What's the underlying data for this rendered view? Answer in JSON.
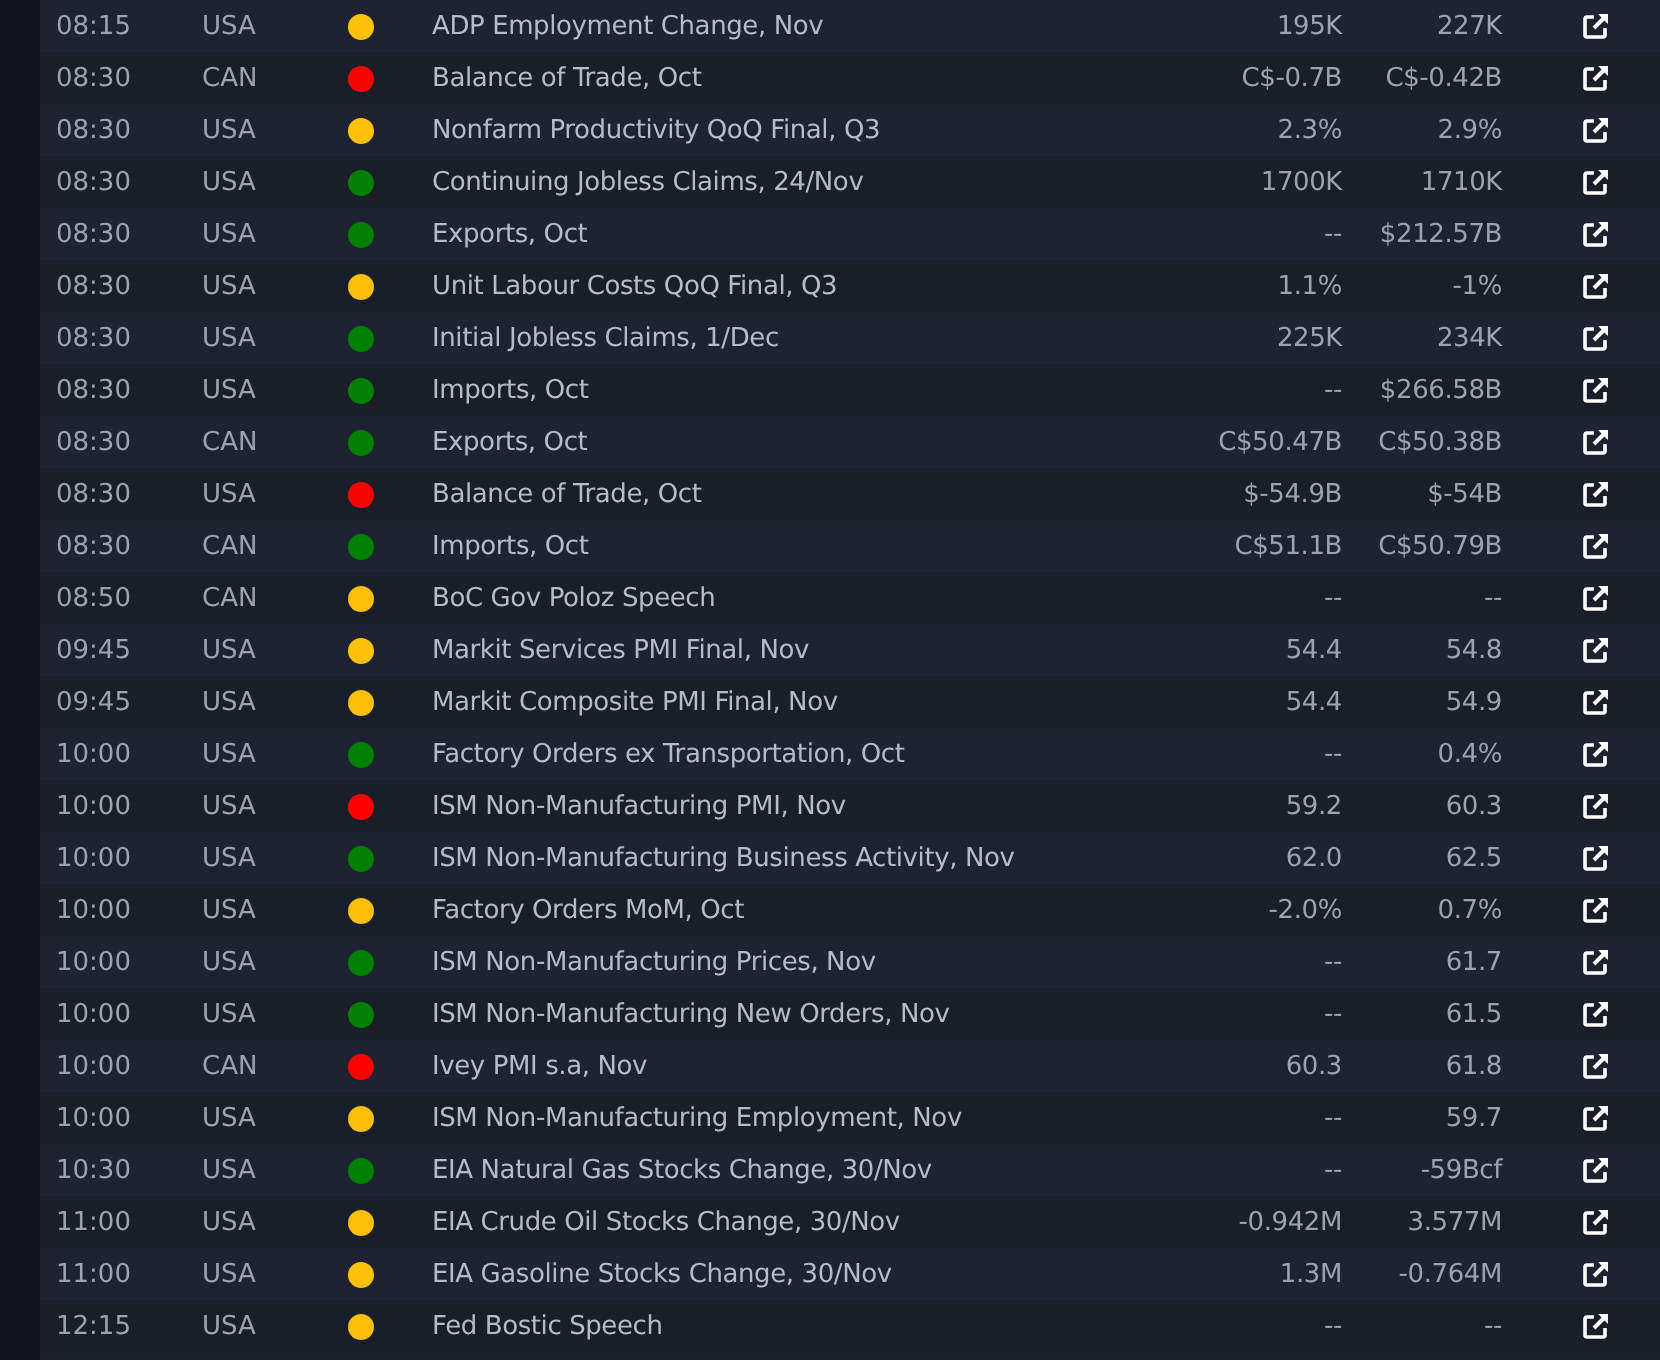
{
  "events": [
    {
      "time": "08:15",
      "country": "USA",
      "color": "#ffc107",
      "event": "ADP Employment Change, Nov",
      "actual": "195K",
      "forecast": "227K"
    },
    {
      "time": "08:30",
      "country": "CAN",
      "color": "#ff0000",
      "event": "Balance of Trade, Oct",
      "actual": "C$-0.7B",
      "forecast": "C$-0.42B"
    },
    {
      "time": "08:30",
      "country": "USA",
      "color": "#ffc107",
      "event": "Nonfarm Productivity QoQ Final, Q3",
      "actual": "2.3%",
      "forecast": "2.9%"
    },
    {
      "time": "08:30",
      "country": "USA",
      "color": "#008000",
      "event": "Continuing Jobless Claims, 24/Nov",
      "actual": "1700K",
      "forecast": "1710K"
    },
    {
      "time": "08:30",
      "country": "USA",
      "color": "#008000",
      "event": "Exports, Oct",
      "actual": "--",
      "forecast": "$212.57B"
    },
    {
      "time": "08:30",
      "country": "USA",
      "color": "#ffc107",
      "event": "Unit Labour Costs QoQ Final, Q3",
      "actual": "1.1%",
      "forecast": "-1%"
    },
    {
      "time": "08:30",
      "country": "USA",
      "color": "#008000",
      "event": "Initial Jobless Claims, 1/Dec",
      "actual": "225K",
      "forecast": "234K"
    },
    {
      "time": "08:30",
      "country": "USA",
      "color": "#008000",
      "event": "Imports, Oct",
      "actual": "--",
      "forecast": "$266.58B"
    },
    {
      "time": "08:30",
      "country": "CAN",
      "color": "#008000",
      "event": "Exports, Oct",
      "actual": "C$50.47B",
      "forecast": "C$50.38B"
    },
    {
      "time": "08:30",
      "country": "USA",
      "color": "#ff0000",
      "event": "Balance of Trade, Oct",
      "actual": "$-54.9B",
      "forecast": "$-54B"
    },
    {
      "time": "08:30",
      "country": "CAN",
      "color": "#008000",
      "event": "Imports, Oct",
      "actual": "C$51.1B",
      "forecast": "C$50.79B"
    },
    {
      "time": "08:50",
      "country": "CAN",
      "color": "#ffc107",
      "event": "BoC Gov Poloz Speech",
      "actual": "--",
      "forecast": "--"
    },
    {
      "time": "09:45",
      "country": "USA",
      "color": "#ffc107",
      "event": "Markit Services PMI Final, Nov",
      "actual": "54.4",
      "forecast": "54.8"
    },
    {
      "time": "09:45",
      "country": "USA",
      "color": "#ffc107",
      "event": "Markit Composite PMI Final, Nov",
      "actual": "54.4",
      "forecast": "54.9"
    },
    {
      "time": "10:00",
      "country": "USA",
      "color": "#008000",
      "event": "Factory Orders ex Transportation, Oct",
      "actual": "--",
      "forecast": "0.4%"
    },
    {
      "time": "10:00",
      "country": "USA",
      "color": "#ff0000",
      "event": "ISM Non-Manufacturing PMI, Nov",
      "actual": "59.2",
      "forecast": "60.3"
    },
    {
      "time": "10:00",
      "country": "USA",
      "color": "#008000",
      "event": "ISM Non-Manufacturing Business Activity, Nov",
      "actual": "62.0",
      "forecast": "62.5"
    },
    {
      "time": "10:00",
      "country": "USA",
      "color": "#ffc107",
      "event": "Factory Orders MoM, Oct",
      "actual": "-2.0%",
      "forecast": "0.7%"
    },
    {
      "time": "10:00",
      "country": "USA",
      "color": "#008000",
      "event": "ISM Non-Manufacturing Prices, Nov",
      "actual": "--",
      "forecast": "61.7"
    },
    {
      "time": "10:00",
      "country": "USA",
      "color": "#008000",
      "event": "ISM Non-Manufacturing New Orders, Nov",
      "actual": "--",
      "forecast": "61.5"
    },
    {
      "time": "10:00",
      "country": "CAN",
      "color": "#ff0000",
      "event": "Ivey PMI s.a, Nov",
      "actual": "60.3",
      "forecast": "61.8"
    },
    {
      "time": "10:00",
      "country": "USA",
      "color": "#ffc107",
      "event": "ISM Non-Manufacturing Employment, Nov",
      "actual": "--",
      "forecast": "59.7"
    },
    {
      "time": "10:30",
      "country": "USA",
      "color": "#008000",
      "event": "EIA Natural Gas Stocks Change, 30/Nov",
      "actual": "--",
      "forecast": "-59Bcf"
    },
    {
      "time": "11:00",
      "country": "USA",
      "color": "#ffc107",
      "event": "EIA Crude Oil Stocks Change, 30/Nov",
      "actual": "-0.942M",
      "forecast": "3.577M"
    },
    {
      "time": "11:00",
      "country": "USA",
      "color": "#ffc107",
      "event": "EIA Gasoline Stocks Change, 30/Nov",
      "actual": "1.3M",
      "forecast": "-0.764M"
    },
    {
      "time": "12:15",
      "country": "USA",
      "color": "#ffc107",
      "event": "Fed Bostic Speech",
      "actual": "--",
      "forecast": "--"
    }
  ]
}
